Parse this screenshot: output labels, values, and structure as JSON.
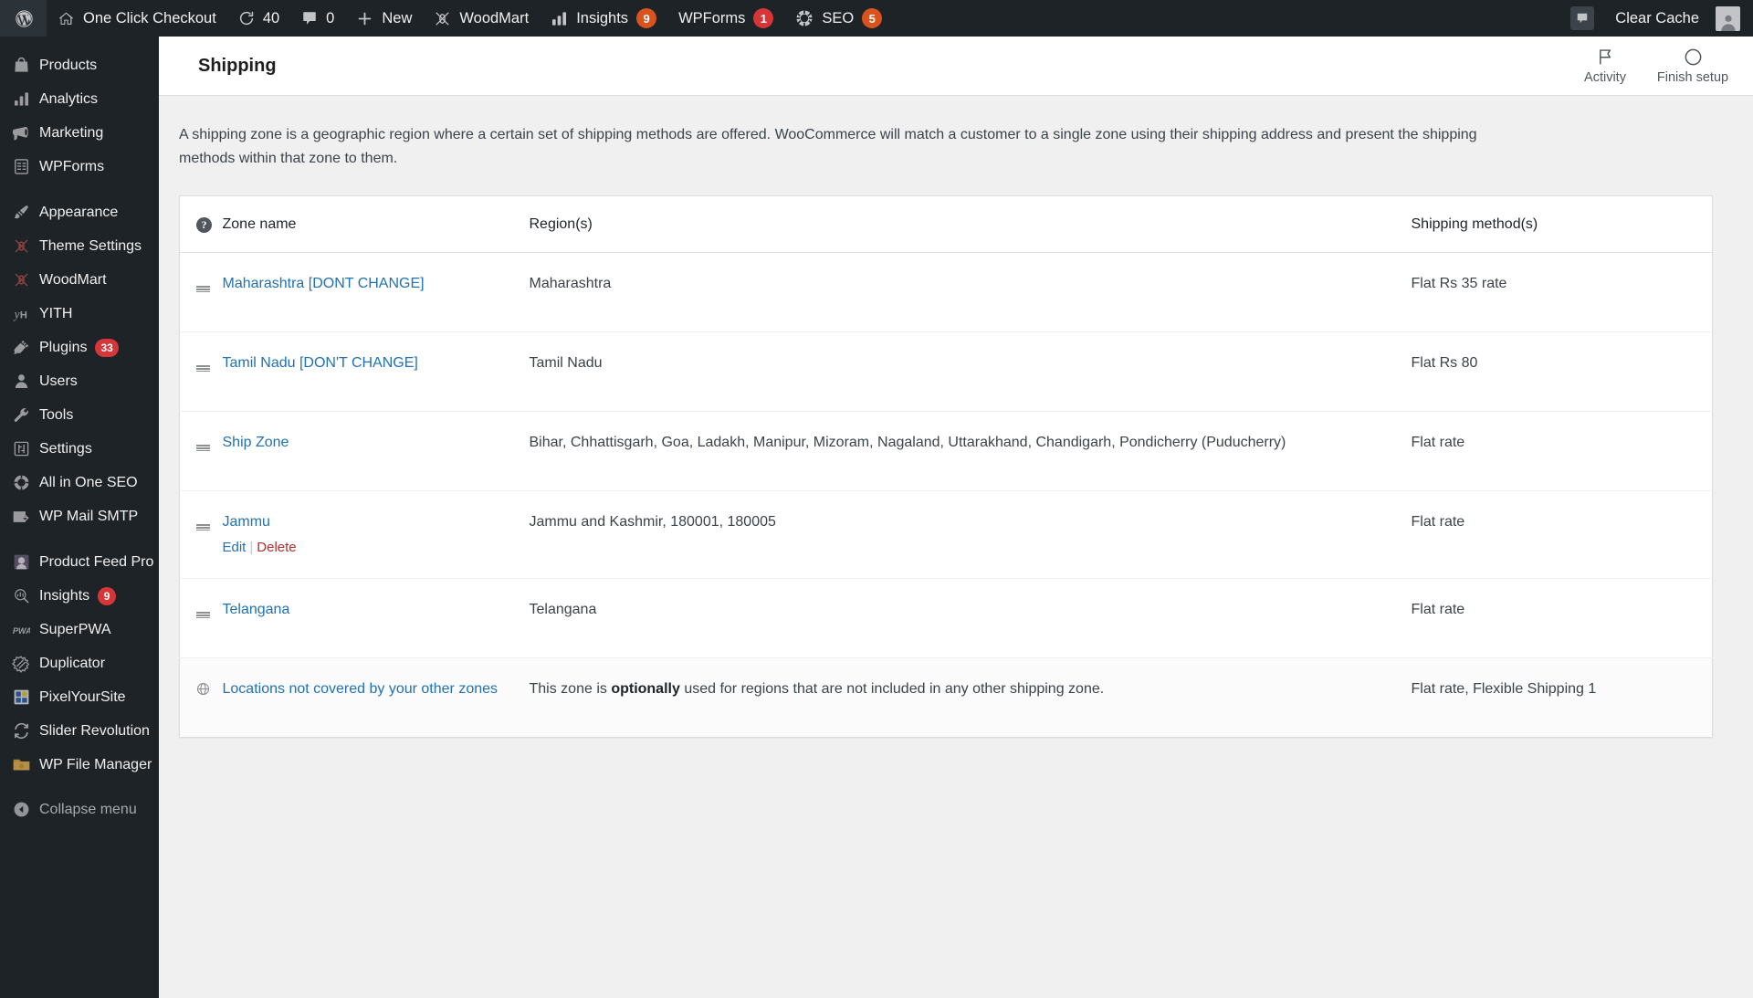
{
  "adminbar": {
    "wp_logo": "wordpress-icon",
    "items": [
      {
        "icon": "home-icon",
        "label": "One Click Checkout",
        "count": null,
        "count_color": null
      },
      {
        "icon": "updates-icon",
        "label": "40",
        "count": null,
        "count_color": null
      },
      {
        "icon": "comment-icon",
        "label": "0",
        "count": null,
        "count_color": null
      },
      {
        "icon": "plus-icon",
        "label": "New",
        "count": null,
        "count_color": null
      },
      {
        "icon": "woodmart-icon",
        "label": "WoodMart",
        "count": null,
        "count_color": null
      },
      {
        "icon": "chart-icon",
        "label": "Insights",
        "count": "9",
        "count_color": "#d9531e"
      },
      {
        "icon": null,
        "label": "WPForms",
        "count": "1",
        "count_color": "#d63638"
      },
      {
        "icon": "gear-icon",
        "label": "SEO",
        "count": "5",
        "count_color": "#d9531e"
      }
    ],
    "clear_cache": {
      "icon": "cache-icon",
      "label": "Clear Cache"
    },
    "avatar": "user-avatar"
  },
  "sidebar": {
    "items": [
      {
        "icon": "products-icon",
        "label": "Products",
        "badge": null
      },
      {
        "icon": "analytics-icon",
        "label": "Analytics",
        "badge": null
      },
      {
        "icon": "megaphone-icon",
        "label": "Marketing",
        "badge": null
      },
      {
        "icon": "wpforms-icon",
        "label": "WPForms",
        "badge": null
      },
      {
        "separator": true
      },
      {
        "icon": "paintbrush-icon",
        "label": "Appearance",
        "badge": null
      },
      {
        "icon": "theme-settings-icon",
        "label": "Theme Settings",
        "badge": null
      },
      {
        "icon": "woodmart-icon",
        "label": "WoodMart",
        "badge": null
      },
      {
        "icon": "yith-icon",
        "label": "YITH",
        "badge": null
      },
      {
        "icon": "plugins-icon",
        "label": "Plugins",
        "badge": "33"
      },
      {
        "icon": "users-icon",
        "label": "Users",
        "badge": null
      },
      {
        "icon": "tools-icon",
        "label": "Tools",
        "badge": null
      },
      {
        "icon": "settings-icon",
        "label": "Settings",
        "badge": null
      },
      {
        "icon": "aioseo-icon",
        "label": "All in One SEO",
        "badge": null
      },
      {
        "icon": "mail-icon",
        "label": "WP Mail SMTP",
        "badge": null
      },
      {
        "separator": true
      },
      {
        "icon": "product-feed-icon",
        "label": "Product Feed Pro",
        "badge": null
      },
      {
        "icon": "insights-icon",
        "label": "Insights",
        "badge": "9"
      },
      {
        "icon": "superpwa-icon",
        "label": "SuperPWA",
        "badge": null
      },
      {
        "icon": "duplicator-icon",
        "label": "Duplicator",
        "badge": null
      },
      {
        "icon": "pixelyoursite-icon",
        "label": "PixelYourSite",
        "badge": null
      },
      {
        "icon": "slider-revolution-icon",
        "label": "Slider Revolution",
        "badge": null
      },
      {
        "icon": "folder-icon",
        "label": "WP File Manager",
        "badge": null
      }
    ],
    "collapse": {
      "icon": "collapse-arrow-icon",
      "label": "Collapse menu"
    }
  },
  "header": {
    "title": "Shipping",
    "activity": {
      "icon": "flag-icon",
      "label": "Activity"
    },
    "finish_setup": {
      "icon": "circle-progress-icon",
      "label": "Finish setup"
    }
  },
  "main": {
    "intro": "A shipping zone is a geographic region where a certain set of shipping methods are offered. WooCommerce will match a customer to a single zone using their shipping address and present the shipping methods within that zone to them.",
    "table": {
      "help_tip": "?",
      "columns": [
        "Zone name",
        "Region(s)",
        "Shipping method(s)"
      ],
      "rows": [
        {
          "handle": "drag-handle-icon",
          "zone_name": "Maharashtra [DONT CHANGE]",
          "regions": "Maharashtra",
          "methods": "Flat Rs 35 rate",
          "actions": null
        },
        {
          "handle": "drag-handle-icon",
          "zone_name": "Tamil Nadu [DON'T CHANGE]",
          "regions": "Tamil Nadu",
          "methods": "Flat Rs 80",
          "actions": null
        },
        {
          "handle": "drag-handle-icon",
          "zone_name": "Ship Zone",
          "regions": "Bihar, Chhattisgarh, Goa, Ladakh, Manipur, Mizoram, Nagaland, Uttarakhand, Chandigarh, Pondicherry (Puducherry)",
          "methods": "Flat rate",
          "actions": null
        },
        {
          "handle": "drag-handle-icon",
          "zone_name": "Jammu",
          "regions": "Jammu and Kashmir, 180001, 180005",
          "methods": "Flat rate",
          "actions": {
            "edit": "Edit",
            "separator": "|",
            "delete": "Delete"
          }
        },
        {
          "handle": "drag-handle-icon",
          "zone_name": "Telangana",
          "regions": "Telangana",
          "methods": "Flat rate",
          "actions": null
        }
      ],
      "worldwide_row": {
        "handle": "globe-icon",
        "zone_name": "Locations not covered by your other zones",
        "regions_prefix": "This zone is ",
        "regions_bold": "optionally",
        "regions_suffix": " used for regions that are not included in any other shipping zone.",
        "methods": "Flat rate, Flexible Shipping 1"
      }
    }
  },
  "colors": {
    "admin_dark": "#1d2327",
    "link_blue": "#2271b1",
    "delete_red": "#b32d2e",
    "badge_red": "#d63638",
    "badge_orange": "#d9531e",
    "page_bg": "#f0f0f1"
  }
}
